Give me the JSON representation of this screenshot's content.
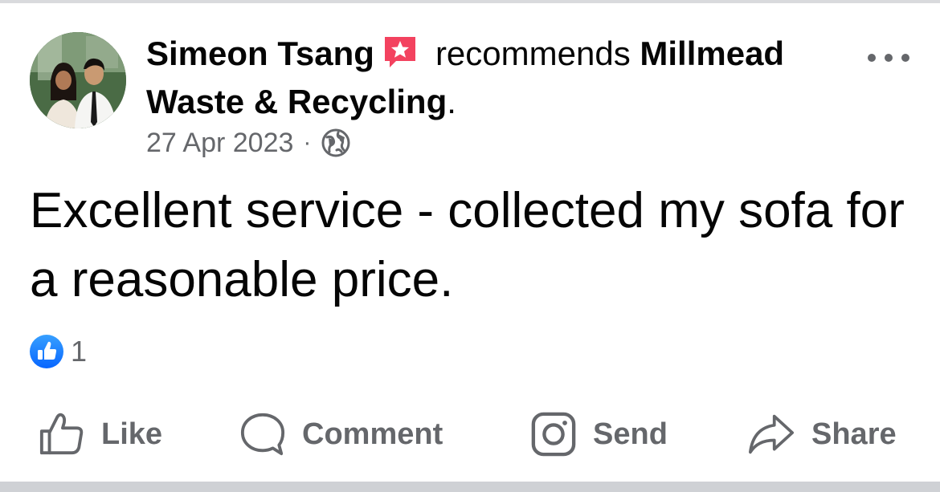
{
  "post": {
    "author": "Simeon Tsang",
    "action_text": "recommends",
    "page_name": "Millmead Waste & Recycling",
    "period": ".",
    "date": "27 Apr 2023",
    "separator": "·",
    "audience_icon": "globe-icon",
    "body": "Excellent service - collected my sofa for a reasonable price.",
    "reaction_count": "1",
    "reaction_icon": "thumbs-up-icon",
    "badge_icon": "star-recommend-icon",
    "badge_color": "#f3425f",
    "like_color": "#1877f2"
  },
  "actions": {
    "like": "Like",
    "comment": "Comment",
    "send": "Send",
    "share": "Share"
  },
  "colors": {
    "text_primary": "#050505",
    "text_secondary": "#65676b",
    "divider": "#d9dadd"
  }
}
